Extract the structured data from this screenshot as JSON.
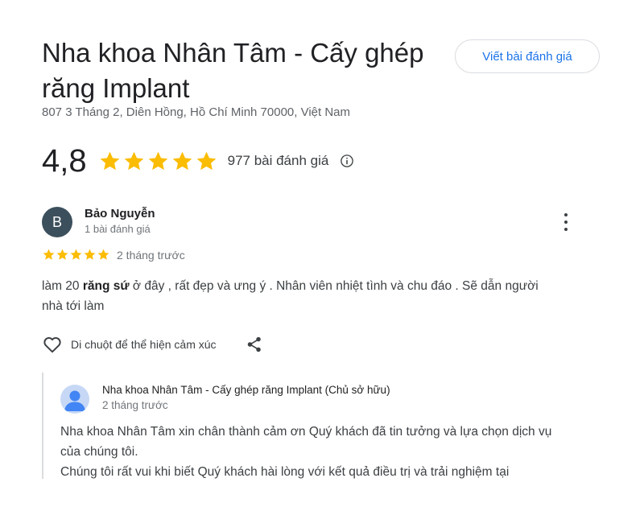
{
  "business": {
    "name": "Nha khoa Nhân Tâm - Cấy ghép răng Implant",
    "address": "807 3 Tháng 2, Diên Hồng, Hồ Chí Minh 70000, Việt Nam",
    "rating": "4,8",
    "stars": 5,
    "review_count": "977 bài đánh giá",
    "write_review_label": "Viết bài đánh giá"
  },
  "review": {
    "avatar_letter": "B",
    "author": "Bảo Nguyễn",
    "author_meta": "1 bài đánh giá",
    "stars": 5,
    "time": "2 tháng trước",
    "text_before": "làm 20 ",
    "text_bold": "răng sứ",
    "text_after": " ở đây , rất đẹp và ưng ý . Nhân viên nhiệt tình và chu đáo . Sẽ dẫn người nhà tới làm",
    "react_label": "Di chuột để thể hiện cảm xúc"
  },
  "owner_reply": {
    "name": "Nha khoa Nhân Tâm - Cấy ghép răng Implant (Chủ sở hữu)",
    "time": "2 tháng trước",
    "paragraph1": "Nha khoa Nhân Tâm xin chân thành cảm ơn Quý khách đã tin tưởng và lựa chọn dịch vụ của chúng tôi.",
    "paragraph2": "Chúng tôi rất vui khi biết Quý khách hài lòng với kết quả điều trị và trải nghiệm tại"
  },
  "colors": {
    "star": "#fbbc04",
    "link": "#1a73e8",
    "avatar_bg": "#3c4f5c",
    "owner_avatar_bg": "#c6d8f5"
  }
}
